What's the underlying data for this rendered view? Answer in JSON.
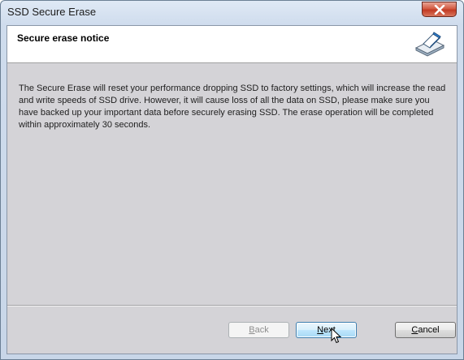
{
  "window": {
    "title": "SSD Secure Erase",
    "close_icon": "close-icon"
  },
  "header": {
    "title": "Secure erase notice",
    "icon": "eraser-icon"
  },
  "notice": {
    "text": "The Secure Erase will reset your performance dropping SSD to factory settings, which will increase the read and write speeds of SSD drive. However, it will cause loss of all the data on SSD, please make sure you have backed up your important data before securely erasing SSD. The erase operation will be completed within approximately 30 seconds."
  },
  "buttons": {
    "back": {
      "label": "Back",
      "mnemonic": "B",
      "rest": "ack",
      "enabled": false
    },
    "next": {
      "label": "Next",
      "mnemonic": "N",
      "rest": "ext",
      "enabled": true
    },
    "cancel": {
      "label": "Cancel",
      "mnemonic": "C",
      "rest": "ancel",
      "enabled": true
    }
  },
  "colors": {
    "close_button": "#c23a23",
    "focus_button_border": "#3c7fb1",
    "client_background": "#d4d3d7"
  }
}
